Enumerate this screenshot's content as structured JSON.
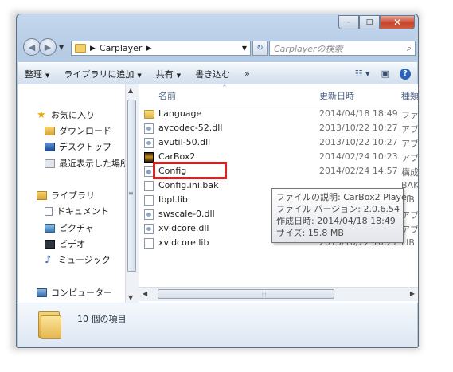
{
  "window": {
    "caption_buttons": [
      "–",
      "□",
      "✕"
    ]
  },
  "address": {
    "breadcrumb": "Carplayer",
    "search_placeholder": "Carplayerの検索"
  },
  "toolbar": {
    "organize": "整理",
    "add_to_library": "ライブラリに追加",
    "share": "共有",
    "burn": "書き込む",
    "more": "»"
  },
  "navpane": {
    "favorites": "お気に入り",
    "downloads": "ダウンロード",
    "desktop": "デスクトップ",
    "recent": "最近表示した場所",
    "libraries": "ライブラリ",
    "documents": "ドキュメント",
    "pictures": "ピクチャ",
    "videos": "ビデオ",
    "music": "ミュージック",
    "computer": "コンピューター"
  },
  "columns": {
    "name": "名前",
    "modified": "更新日時",
    "type": "種類"
  },
  "files": [
    {
      "name": "Language",
      "date": "2014/04/18 18:49",
      "type": "ファ",
      "icon": "folder-icon"
    },
    {
      "name": "avcodec-52.dll",
      "date": "2013/10/22 10:27",
      "type": "アプ",
      "icon": "dll-file-icon"
    },
    {
      "name": "avutil-50.dll",
      "date": "2013/10/22 10:27",
      "type": "アプ",
      "icon": "dll-file-icon"
    },
    {
      "name": "CarBox2",
      "date": "2014/02/24 10:23",
      "type": "アプ",
      "icon": "application-icon"
    },
    {
      "name": "Config",
      "date": "2014/02/24 14:57",
      "type": "構成",
      "icon": "config-file-icon"
    },
    {
      "name": "Config.ini.bak",
      "date": "",
      "type": "BAK",
      "icon": "text-file-icon"
    },
    {
      "name": "Ibpl.lib",
      "date": "",
      "type": "LIB",
      "icon": "text-file-icon"
    },
    {
      "name": "swscale-0.dll",
      "date": "",
      "type": "アプ",
      "icon": "dll-file-icon"
    },
    {
      "name": "xvidcore.dll",
      "date": "",
      "type": "アプ",
      "icon": "dll-file-icon"
    },
    {
      "name": "xvidcore.lib",
      "date": "2013/10/22 10:27",
      "type": "LIB",
      "icon": "text-file-icon"
    }
  ],
  "tooltip": {
    "description": "ファイルの説明: CarBox2 Player",
    "version": "ファイル バージョン: 2.0.6.54",
    "created": "作成日時: 2014/04/18 18:49",
    "size": "サイズ: 15.8 MB"
  },
  "status": {
    "item_count": "10 個の項目"
  },
  "colors": {
    "highlight_border": "#e02020",
    "window_frame": "#b6cbe4"
  }
}
